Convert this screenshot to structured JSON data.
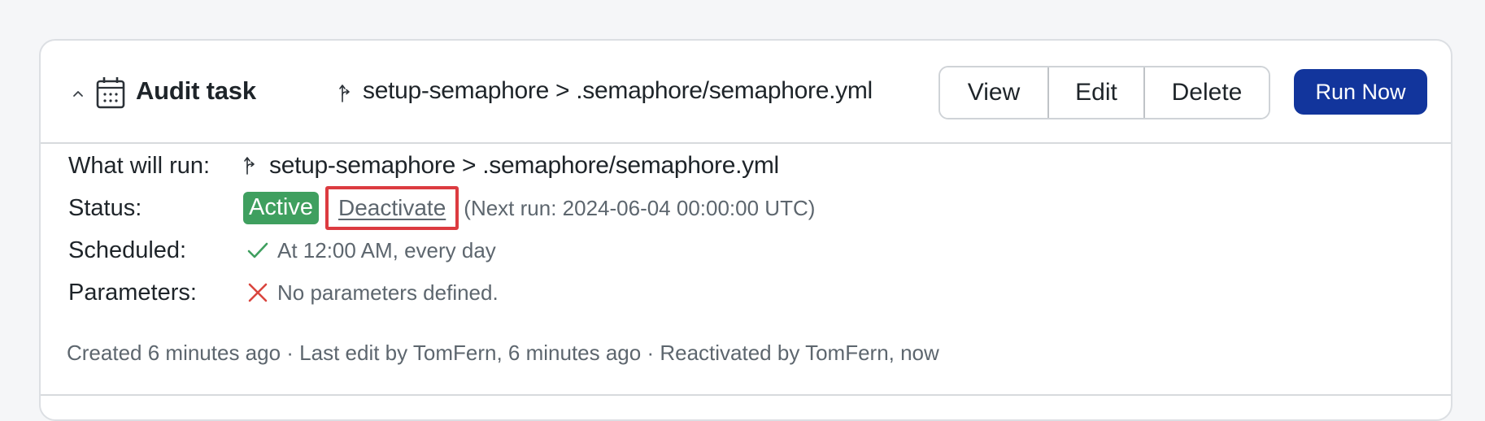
{
  "task": {
    "title": "Audit task",
    "branch": "setup-semaphore",
    "pipeline_file": ".semaphore/semaphore.yml",
    "path_display": "setup-semaphore > .semaphore/semaphore.yml"
  },
  "header": {
    "collapse_icon": "chevron-up-icon",
    "task_icon": "calendar-icon",
    "branch_icon": "git-branch-icon",
    "actions": {
      "view_label": "View",
      "edit_label": "Edit",
      "delete_label": "Delete",
      "run_now_label": "Run Now"
    }
  },
  "details": {
    "what_will_run": {
      "label": "What will run:",
      "value": "setup-semaphore > .semaphore/semaphore.yml"
    },
    "status": {
      "label": "Status:",
      "badge": "Active",
      "action_link": "Deactivate",
      "next_run": "(Next run: 2024-06-04 00:00:00 UTC)"
    },
    "scheduled": {
      "label": "Scheduled:",
      "icon": "check-icon",
      "value": "At 12:00 AM, every day"
    },
    "parameters": {
      "label": "Parameters:",
      "icon": "x-icon",
      "value": "No parameters defined."
    }
  },
  "footer": {
    "history": "Created 6 minutes ago · Last edit by TomFern, 6 minutes ago · Reactivated by TomFern, now"
  },
  "colors": {
    "primary": "#12359c",
    "active_badge": "#3f9f5f",
    "highlight_border": "#dc3b40",
    "check": "#3f9f5f",
    "cross": "#d9453e",
    "muted_text": "#5d666e"
  }
}
